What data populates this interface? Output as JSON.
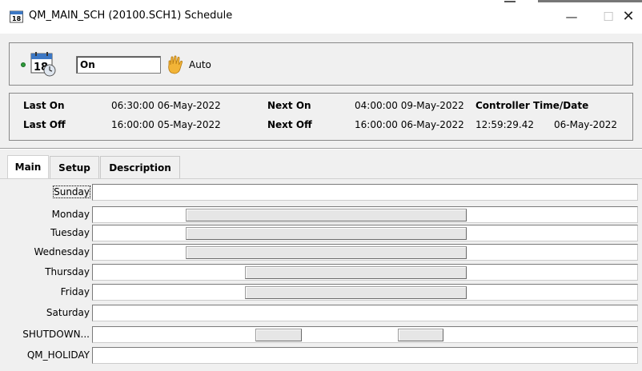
{
  "window": {
    "title": "QM_MAIN_SCH  (20100.SCH1)  Schedule",
    "minimize_glyph": "—",
    "maximize_glyph": "☐",
    "close_glyph": "✕"
  },
  "status": {
    "indicator_color": "#2e9b3a",
    "calendar_day": "18",
    "present_value": "On",
    "mode": "Auto",
    "icons": [
      "status-dot-icon",
      "calendar-clock-icon",
      "hand-icon"
    ]
  },
  "times": {
    "last_on_label": "Last On",
    "last_on_value": "06:30:00 06-May-2022",
    "last_off_label": "Last Off",
    "last_off_value": "16:00:00 05-May-2022",
    "next_on_label": "Next On",
    "next_on_value": "04:00:00 09-May-2022",
    "next_off_label": "Next Off",
    "next_off_value": "16:00:00 06-May-2022",
    "controller_label": "Controller Time/Date",
    "controller_time": "12:59:29.42",
    "controller_date": "06-May-2022"
  },
  "tabs": [
    {
      "label": "Main",
      "active": true
    },
    {
      "label": "Setup",
      "active": false
    },
    {
      "label": "Description",
      "active": false
    }
  ],
  "schedule": {
    "rows": [
      {
        "label": "Sunday",
        "blocks": []
      },
      {
        "label": "Monday",
        "blocks": [
          [
            0.17,
            0.685
          ]
        ]
      },
      {
        "label": "Tuesday",
        "blocks": [
          [
            0.17,
            0.685
          ]
        ]
      },
      {
        "label": "Wednesday",
        "blocks": [
          [
            0.17,
            0.685
          ]
        ]
      },
      {
        "label": "Thursday",
        "blocks": [
          [
            0.279,
            0.685
          ]
        ]
      },
      {
        "label": "Friday",
        "blocks": [
          [
            0.279,
            0.685
          ]
        ]
      },
      {
        "label": "Saturday",
        "blocks": []
      },
      {
        "label": "SHUTDOWN...",
        "blocks": [
          [
            0.298,
            0.383
          ],
          [
            0.558,
            0.641
          ]
        ]
      },
      {
        "label": "QM_HOLIDAY",
        "blocks": []
      }
    ]
  }
}
